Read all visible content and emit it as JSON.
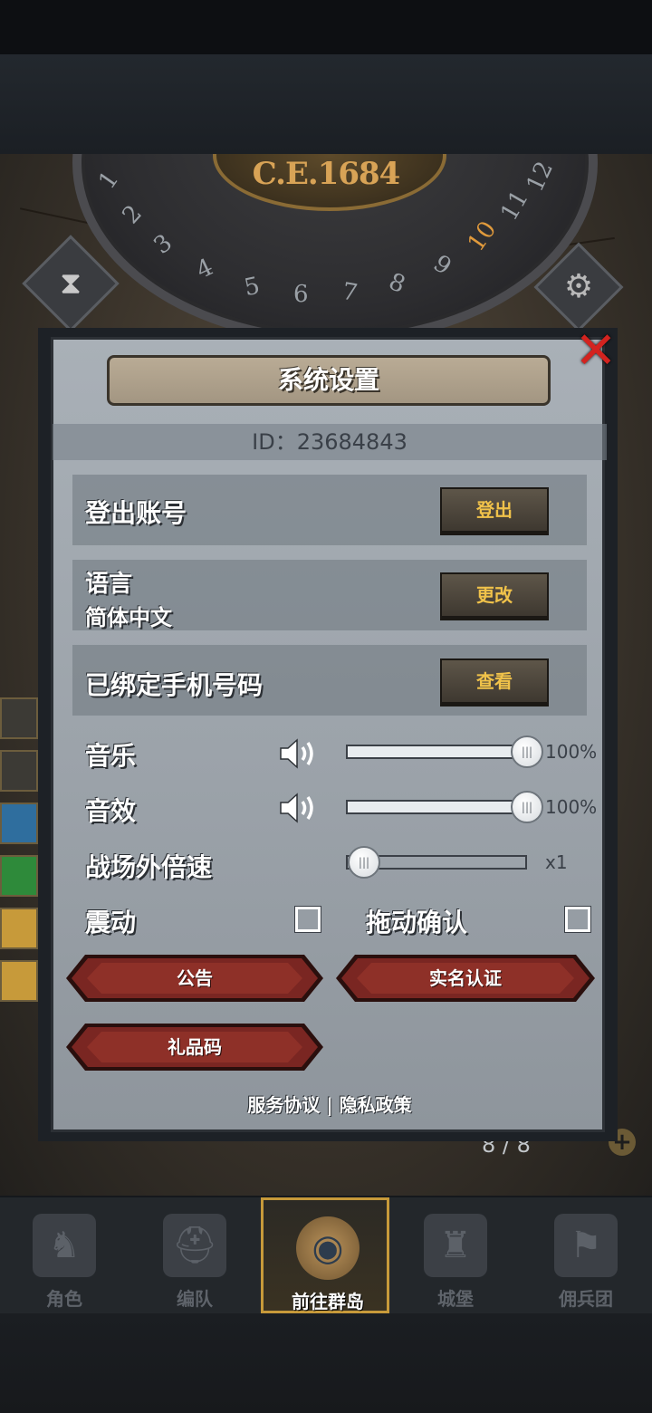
{
  "background": {
    "era_label": "C.E.1684",
    "dial_numbers": [
      "1",
      "2",
      "3",
      "4",
      "5",
      "6",
      "7",
      "8",
      "9",
      "10",
      "11",
      "12"
    ],
    "highlighted_hour": "10",
    "resource_counter": "8 / 8"
  },
  "dialog": {
    "title": "系统设置",
    "id_text": "ID：23684843",
    "rows": [
      {
        "label": "登出账号",
        "button": "登出"
      },
      {
        "label": "语言",
        "sublabel": "简体中文",
        "button": "更改"
      },
      {
        "label": "已绑定手机号码",
        "button": "查看"
      }
    ],
    "sliders": {
      "music": {
        "label": "音乐",
        "value_text": "100%",
        "level": 1.0
      },
      "sfx": {
        "label": "音效",
        "value_text": "100%",
        "level": 1.0
      },
      "speed": {
        "label": "战场外倍速",
        "value_text": "x1",
        "level": 0.0
      }
    },
    "checkboxes": {
      "vibration": {
        "label": "震动",
        "checked": false
      },
      "drag_confirm": {
        "label": "拖动确认",
        "checked": false
      }
    },
    "buttons": {
      "notice": "公告",
      "real_name": "实名认证",
      "gift_code": "礼品码"
    },
    "footer": {
      "service": "服务协议",
      "separator": "|",
      "privacy": "隐私政策"
    }
  },
  "bottom_nav": {
    "items": [
      {
        "label": "角色",
        "icon": "knight-icon"
      },
      {
        "label": "编队",
        "icon": "helmet-icon"
      },
      {
        "label": "前往群岛",
        "icon": "globe-icon"
      },
      {
        "label": "城堡",
        "icon": "castle-icon"
      },
      {
        "label": "佣兵团",
        "icon": "mercenary-icon"
      }
    ],
    "active_index": 2
  },
  "colors": {
    "close_red": "#d3231f",
    "gold_text": "#f0c24a",
    "hex_button_red": "#7a2622",
    "active_nav_border": "#c79a3a"
  }
}
